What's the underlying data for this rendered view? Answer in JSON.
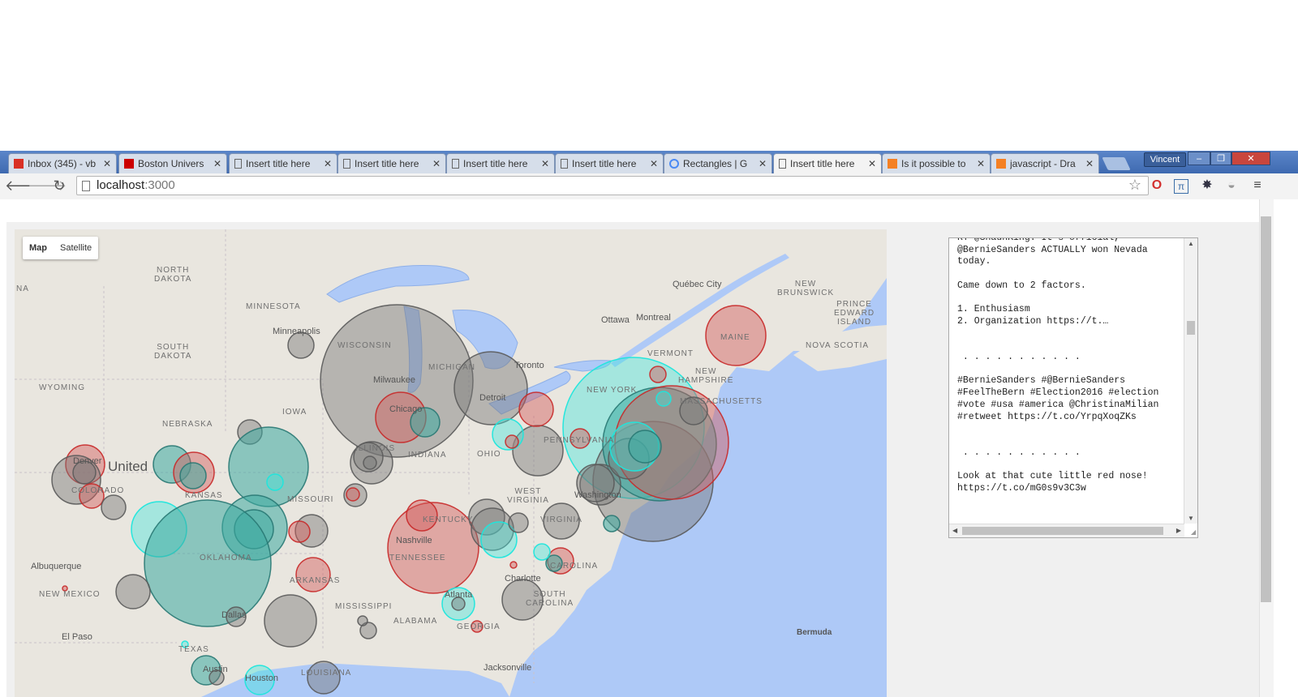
{
  "browser": {
    "tabs": [
      {
        "title": "Inbox (345) - vb",
        "icon": "gmail-icon",
        "icon_color": "#d93025",
        "active": false
      },
      {
        "title": "Boston Univers",
        "icon": "bu-icon",
        "icon_color": "#cc0000",
        "active": false
      },
      {
        "title": "Insert title here",
        "icon": "page-icon",
        "active": false
      },
      {
        "title": "Insert title here",
        "icon": "page-icon",
        "active": false
      },
      {
        "title": "Insert title here",
        "icon": "page-icon",
        "active": false
      },
      {
        "title": "Insert title here",
        "icon": "page-icon",
        "active": false
      },
      {
        "title": "Rectangles | G",
        "icon": "google-dev-icon",
        "active": false
      },
      {
        "title": "Insert title here",
        "icon": "page-icon",
        "active": true
      },
      {
        "title": "Is it possible to",
        "icon": "stackoverflow-icon",
        "icon_color": "#f48024",
        "active": false
      },
      {
        "title": "javascript - Dra",
        "icon": "stackoverflow-icon",
        "icon_color": "#f48024",
        "active": false
      }
    ],
    "profile_name": "Vincent",
    "url_host": "localhost",
    "url_port": ":3000"
  },
  "map": {
    "type_buttons": {
      "map": "Map",
      "satellite": "Satellite"
    },
    "active_type": "Map",
    "region_labels": {
      "north_dakota": "NORTH\nDAKOTA",
      "south_dakota": "SOUTH\nDAKOTA",
      "minnesota": "MINNESOTA",
      "wisconsin": "WISCONSIN",
      "michigan": "MICHIGAN",
      "iowa": "IOWA",
      "nebraska": "NEBRASKA",
      "wyoming": "WYOMING",
      "kansas": "KANSAS",
      "missouri": "MISSOURI",
      "illinois": "ILLINOIS",
      "indiana": "INDIANA",
      "ohio": "OHIO",
      "kentucky": "KENTUCKY",
      "tennessee": "TENNESSEE",
      "oklahoma": "OKLAHOMA",
      "arkansas": "ARKANSAS",
      "mississippi": "MISSISSIPPI",
      "alabama": "ALABAMA",
      "georgia": "GEORGIA",
      "texas": "TEXAS",
      "louisiana": "LOUISIANA",
      "new_mexico": "NEW MEXICO",
      "west_virginia": "WEST\nVIRGINIA",
      "virginia": "VIRGINIA",
      "north_carolina": "CAROLINA",
      "south_carolina": "SOUTH\nCAROLINA",
      "pennsylvania": "PENNSYLVANIA",
      "new_york": "NEW YORK",
      "vermont": "VERMONT",
      "new_hampshire": "NEW\nHAMPSHIRE",
      "massachusetts": "MASSACHUSETTS",
      "maine": "MAINE",
      "new_brunswick": "NEW\nBRUNSWICK",
      "prince_edward_island": "PRINCE\nEDWARD\nISLAND",
      "nova_scotia": "NOVA SCOTIA",
      "colorado": "COLORADO",
      "na": "NA",
      "united": "United"
    },
    "city_labels": {
      "minneapolis": "Minneapolis",
      "milwaukee": "Milwaukee",
      "chicago": "Chicago",
      "detroit": "Detroit",
      "toronto": "Toronto",
      "ottawa": "Ottawa",
      "montreal": "Montreal",
      "quebec_city": "Québec City",
      "nashville": "Nashville",
      "atlanta": "Atlanta",
      "charlotte": "Charlotte",
      "albuquerque": "Albuquerque",
      "el_paso": "El Paso",
      "dallas": "Dallas",
      "austin": "Austin",
      "houston": "Houston",
      "jacksonville": "Jacksonville",
      "bermuda": "Bermuda",
      "denver": "Denver",
      "washington": "Washington"
    },
    "colors": {
      "water": "#aec9f7",
      "land": "#e9e6df",
      "red": "#d06060",
      "gray": "#8a8a8a",
      "teal": "#4fb6ae",
      "cyan": "#35e8e0"
    }
  },
  "tweets": {
    "text": "RT @ShaunKing: It's official,\n@BernieSanders ACTUALLY won Nevada\ntoday.\n\nCame down to 2 factors.\n\n1. Enthusiasm\n2. Organization https://t.…\n\n\n . . . . . . . . . . .\n\n#BernieSanders #@BernieSanders\n#FeelTheBern #Election2016 #election\n#vote #usa #america @ChristinaMilian\n#retweet https://t.co/YrpqXoqZKs\n\n\n . . . . . . . . . . .\n\nLook at that cute little red nose!\nhttps://t.co/mG0s9v3C3w\n\n\n . . . . . . . . . . .\n\nRT @GottaBernNow: #NVCaucus -\n@BernieSanders confirmed as winner of"
  }
}
